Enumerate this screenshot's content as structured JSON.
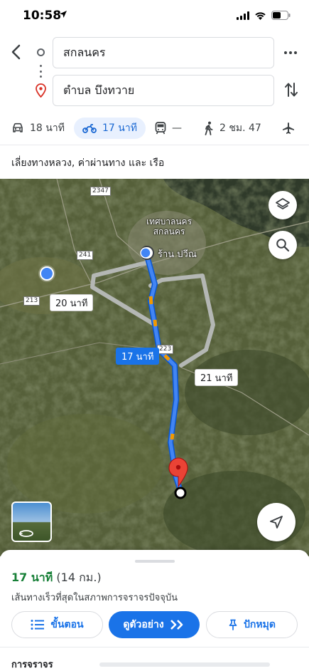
{
  "status": {
    "time": "10:58"
  },
  "route": {
    "origin": "สกลนคร",
    "destination": "ตำบล บึงทวาย"
  },
  "modes": [
    {
      "icon": "car-icon",
      "label": "18 นาที"
    },
    {
      "icon": "motorcycle-icon",
      "label": "17 นาที"
    },
    {
      "icon": "transit-icon",
      "label": "—"
    },
    {
      "icon": "walking-icon",
      "label": "2 ชม. 47"
    },
    {
      "icon": "flight-icon",
      "label": ""
    }
  ],
  "avoid_text": "เลี่ยงทางหลวง, ค่าผ่านทาง และ เรือ",
  "map": {
    "labels": {
      "city_line1": "เทศบาลนคร",
      "city_line2": "สกลนคร",
      "shop": "ร้าน ปวีณ"
    },
    "shields": [
      "2347",
      "241",
      "213",
      "223"
    ],
    "route_times": {
      "alt_left": "20 นาที",
      "main": "17 นาที",
      "alt_right": "21 นาที"
    }
  },
  "sheet": {
    "duration": "17 นาที",
    "distance": "(14 กม.)",
    "description": "เส้นทางเร็วที่สุดในสภาพการจราจรปัจจุบัน",
    "steps_label": "ขั้นตอน",
    "preview_label": "ดูตัวอย่าง",
    "pin_label": "ปักหมุด",
    "traffic_title": "การจราจร"
  },
  "colors": {
    "accent": "#1a73e8",
    "duration_green": "#188038",
    "route_alt": "#b4b7b4",
    "pin_red": "#ea4335"
  }
}
